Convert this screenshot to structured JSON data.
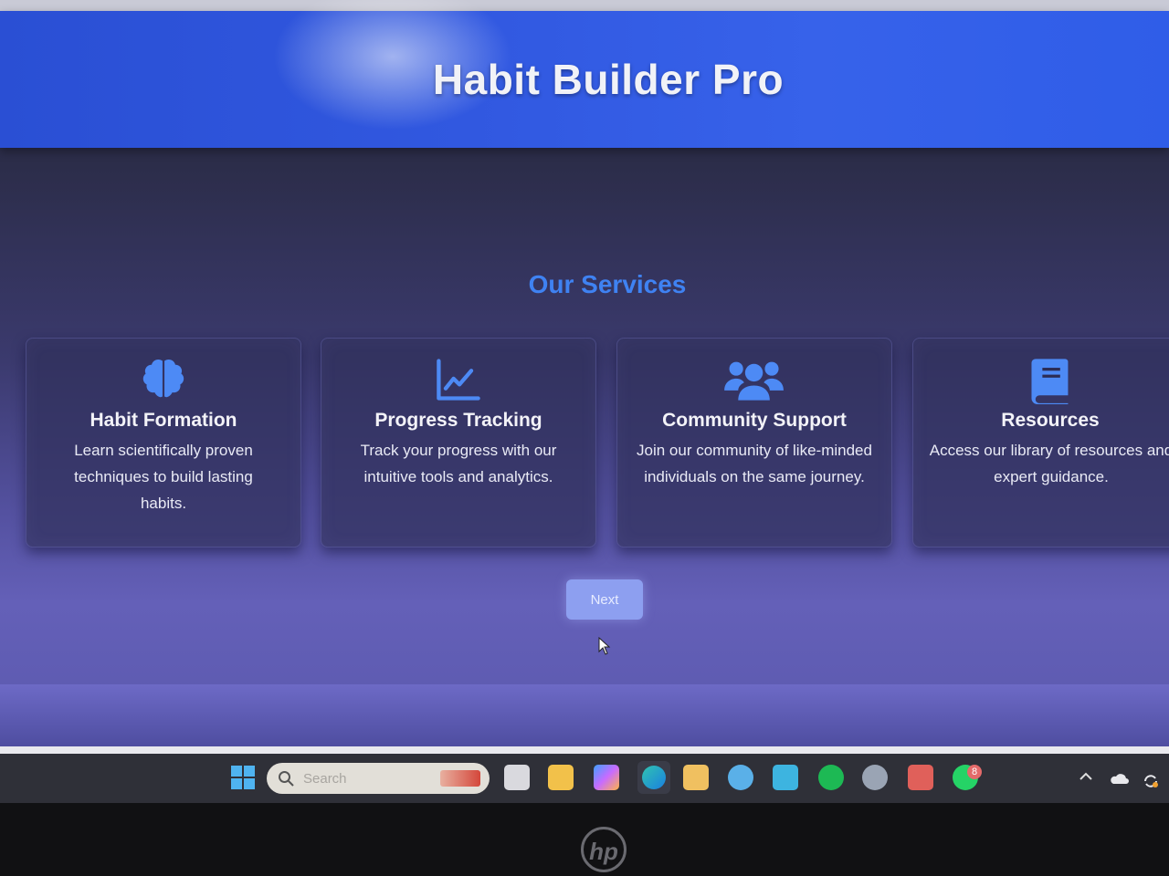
{
  "app": {
    "title": "Habit Builder Pro"
  },
  "services": {
    "heading": "Our Services",
    "cards": [
      {
        "icon": "brain-icon",
        "title": "Habit Formation",
        "description": "Learn scientifically proven techniques to build lasting habits."
      },
      {
        "icon": "chart-line-icon",
        "title": "Progress Tracking",
        "description": "Track your progress with our intuitive tools and analytics."
      },
      {
        "icon": "users-icon",
        "title": "Community Support",
        "description": "Join our community of like-minded individuals on the same journey."
      },
      {
        "icon": "book-icon",
        "title": "Resources",
        "description": "Access our library of resources and expert guidance."
      }
    ],
    "next_label": "Next"
  },
  "taskbar": {
    "search_placeholder": "Search",
    "whatsapp_badge": "8",
    "apps": [
      "windows-start-icon",
      "task-view-icon",
      "file-explorer-icon",
      "copilot-icon",
      "edge-icon",
      "store-icon",
      "weather-icon",
      "app-icon",
      "spotify-icon",
      "settings-icon",
      "app-icon",
      "whatsapp-icon"
    ],
    "tray": [
      "chevron-up-icon",
      "onedrive-icon",
      "sync-icon"
    ]
  },
  "colors": {
    "header": "#3158e0",
    "heading_accent": "#3f82f2",
    "icon_accent": "#4d8af5",
    "button": "#8d9ff0"
  },
  "device": {
    "brand_logo": "hp"
  }
}
